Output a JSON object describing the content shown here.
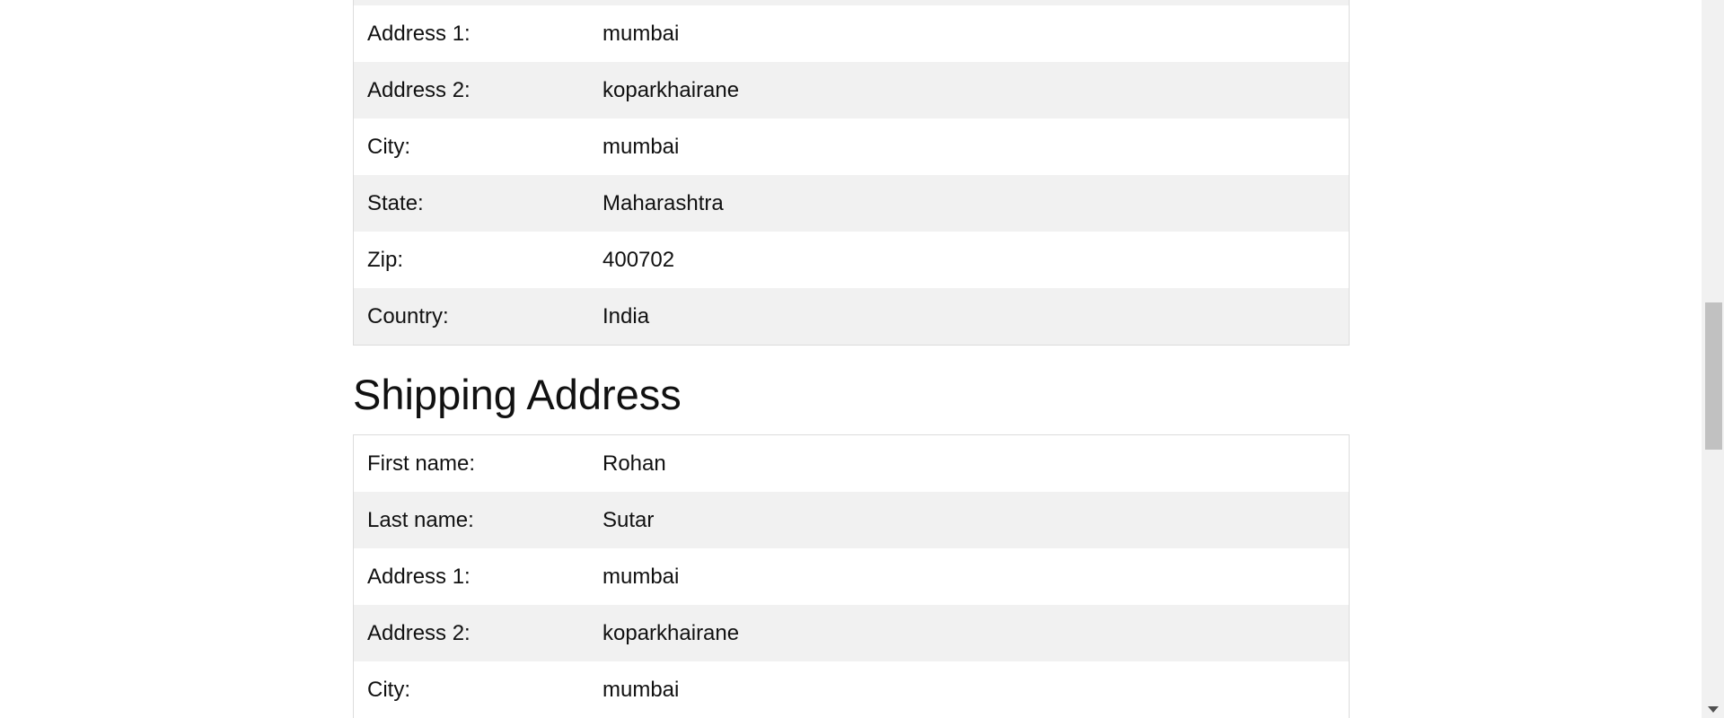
{
  "billing": {
    "rows": [
      {
        "label": "Address 1:",
        "value": "mumbai"
      },
      {
        "label": "Address 2:",
        "value": "koparkhairane"
      },
      {
        "label": "City:",
        "value": "mumbai"
      },
      {
        "label": "State:",
        "value": "Maharashtra"
      },
      {
        "label": "Zip:",
        "value": "400702"
      },
      {
        "label": "Country:",
        "value": "India"
      }
    ]
  },
  "shipping": {
    "title": "Shipping Address",
    "rows": [
      {
        "label": "First name:",
        "value": "Rohan"
      },
      {
        "label": "Last name:",
        "value": "Sutar"
      },
      {
        "label": "Address 1:",
        "value": "mumbai"
      },
      {
        "label": "Address 2:",
        "value": "koparkhairane"
      },
      {
        "label": "City:",
        "value": "mumbai"
      }
    ]
  },
  "colors": {
    "row_alt": "#f1f1f1",
    "border": "#dcdcdc",
    "text": "#111111"
  }
}
